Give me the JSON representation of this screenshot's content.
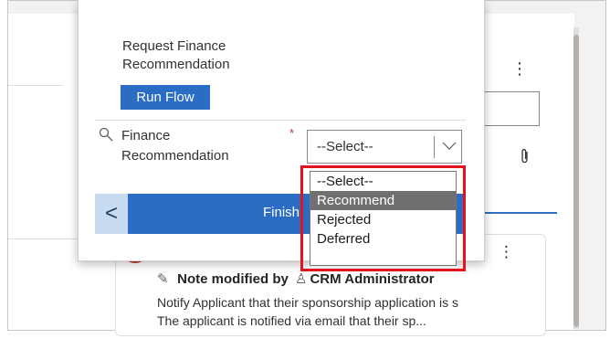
{
  "flow": {
    "step_title": "Request Finance Recommendation",
    "run_flow_label": "Run Flow",
    "field_label": "Finance Recommendation",
    "required_mark": "*",
    "select_value": "--Select--",
    "finish_label": "Finish",
    "back_label": "<"
  },
  "dropdown": {
    "options": [
      "--Select--",
      "Recommend",
      "Rejected",
      "Deferred"
    ],
    "highlighted_index": 1
  },
  "timeline": {
    "note_prefix": "Note modified by",
    "author": "CRM Administrator",
    "line1": "Notify Applicant that their sponsorship application is s",
    "line2": "The applicant is notified via email that their sp...",
    "more": "⋮"
  },
  "toolbar": {
    "more": "⋮"
  },
  "icons": {
    "field": "search-icon",
    "chevron": "chevron-down-icon",
    "attach": "paperclip-icon",
    "edit": "edit-note-icon",
    "user": "person-icon"
  },
  "colors": {
    "accent": "#2b6cc4",
    "highlight": "#e3131d",
    "selected_option": "#707070"
  }
}
